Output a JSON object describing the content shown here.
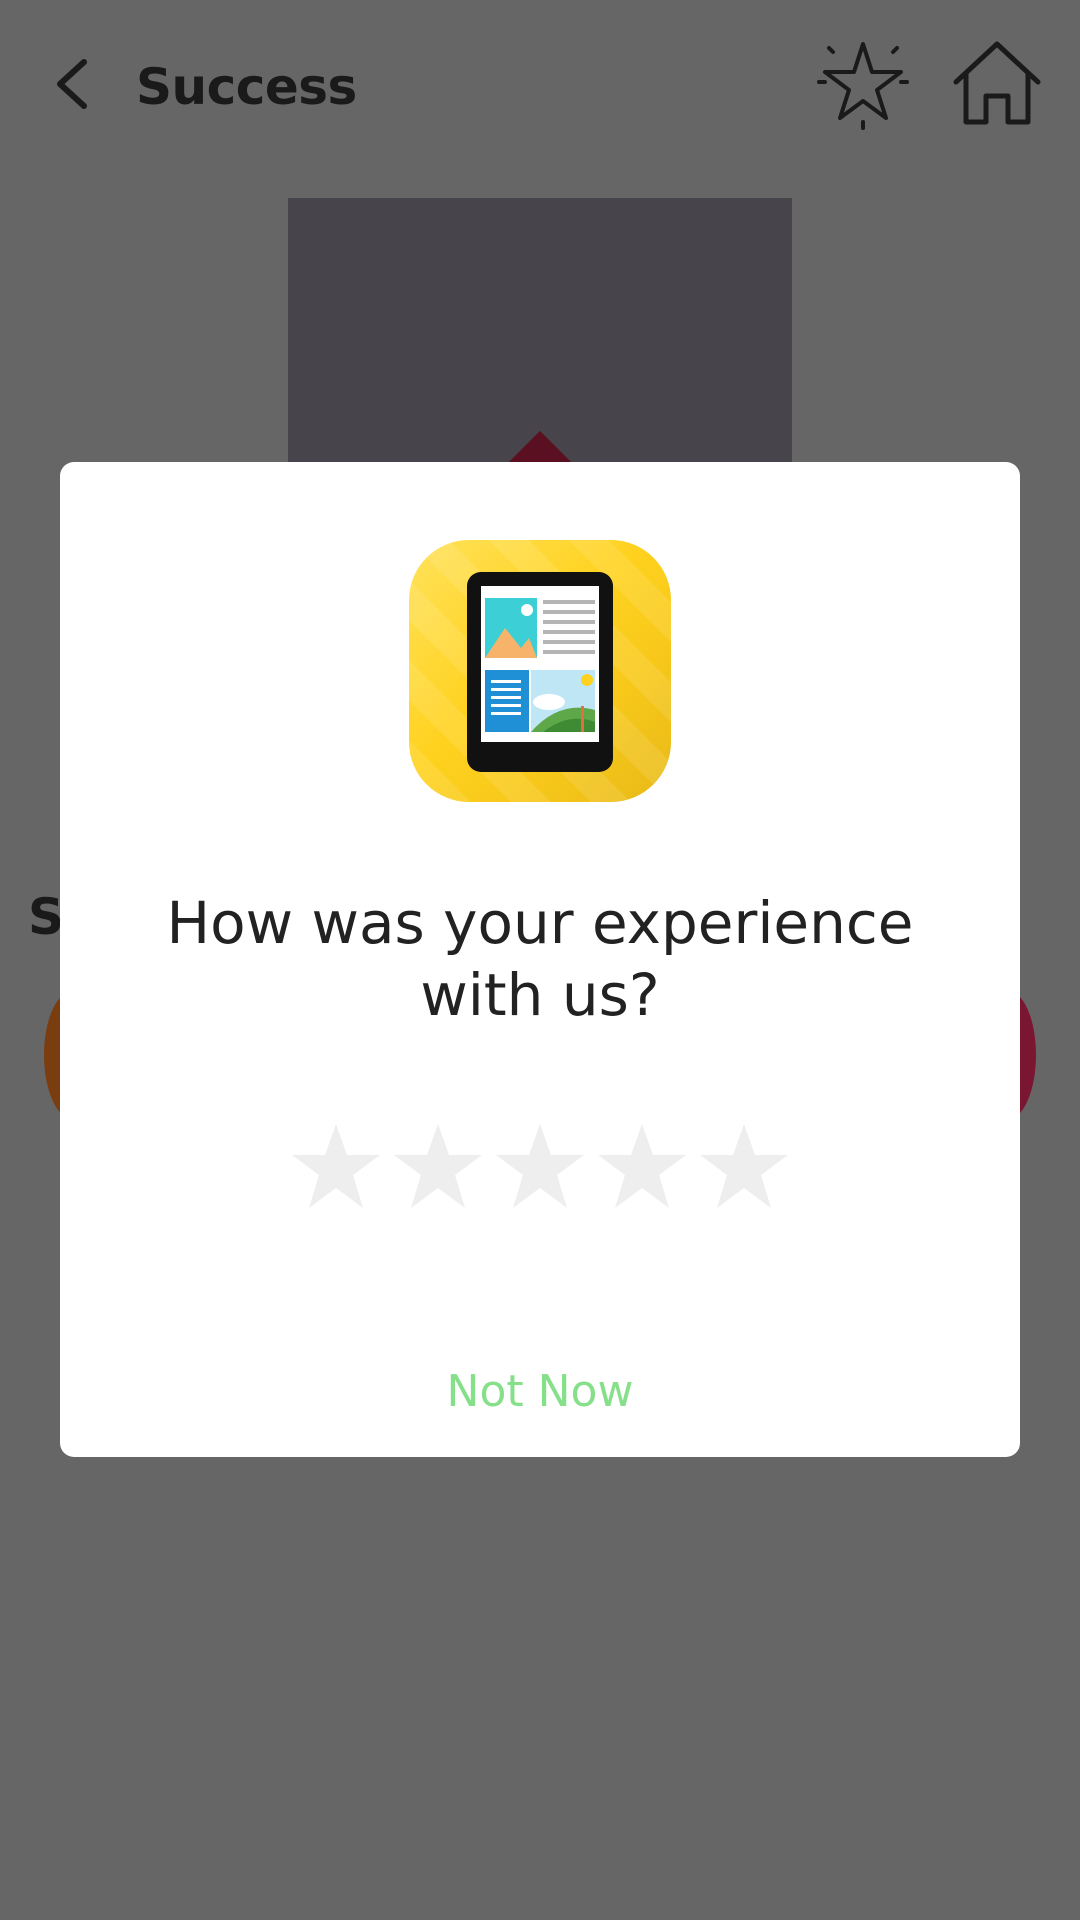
{
  "header": {
    "title": "Success",
    "back_icon": "chevron-left-icon",
    "favorite_icon": "star-outline-icon",
    "home_icon": "home-icon"
  },
  "background": {
    "partial_text": "S"
  },
  "dialog": {
    "app_icon": "tablet-reader-icon",
    "question": "How was your experience with us?",
    "rating": {
      "max": 5,
      "value": 0
    },
    "not_now_label": "Not Now",
    "colors": {
      "star_empty": "#eeeeee",
      "not_now": "#86e08a",
      "icon_background": "#ffd21f"
    }
  }
}
